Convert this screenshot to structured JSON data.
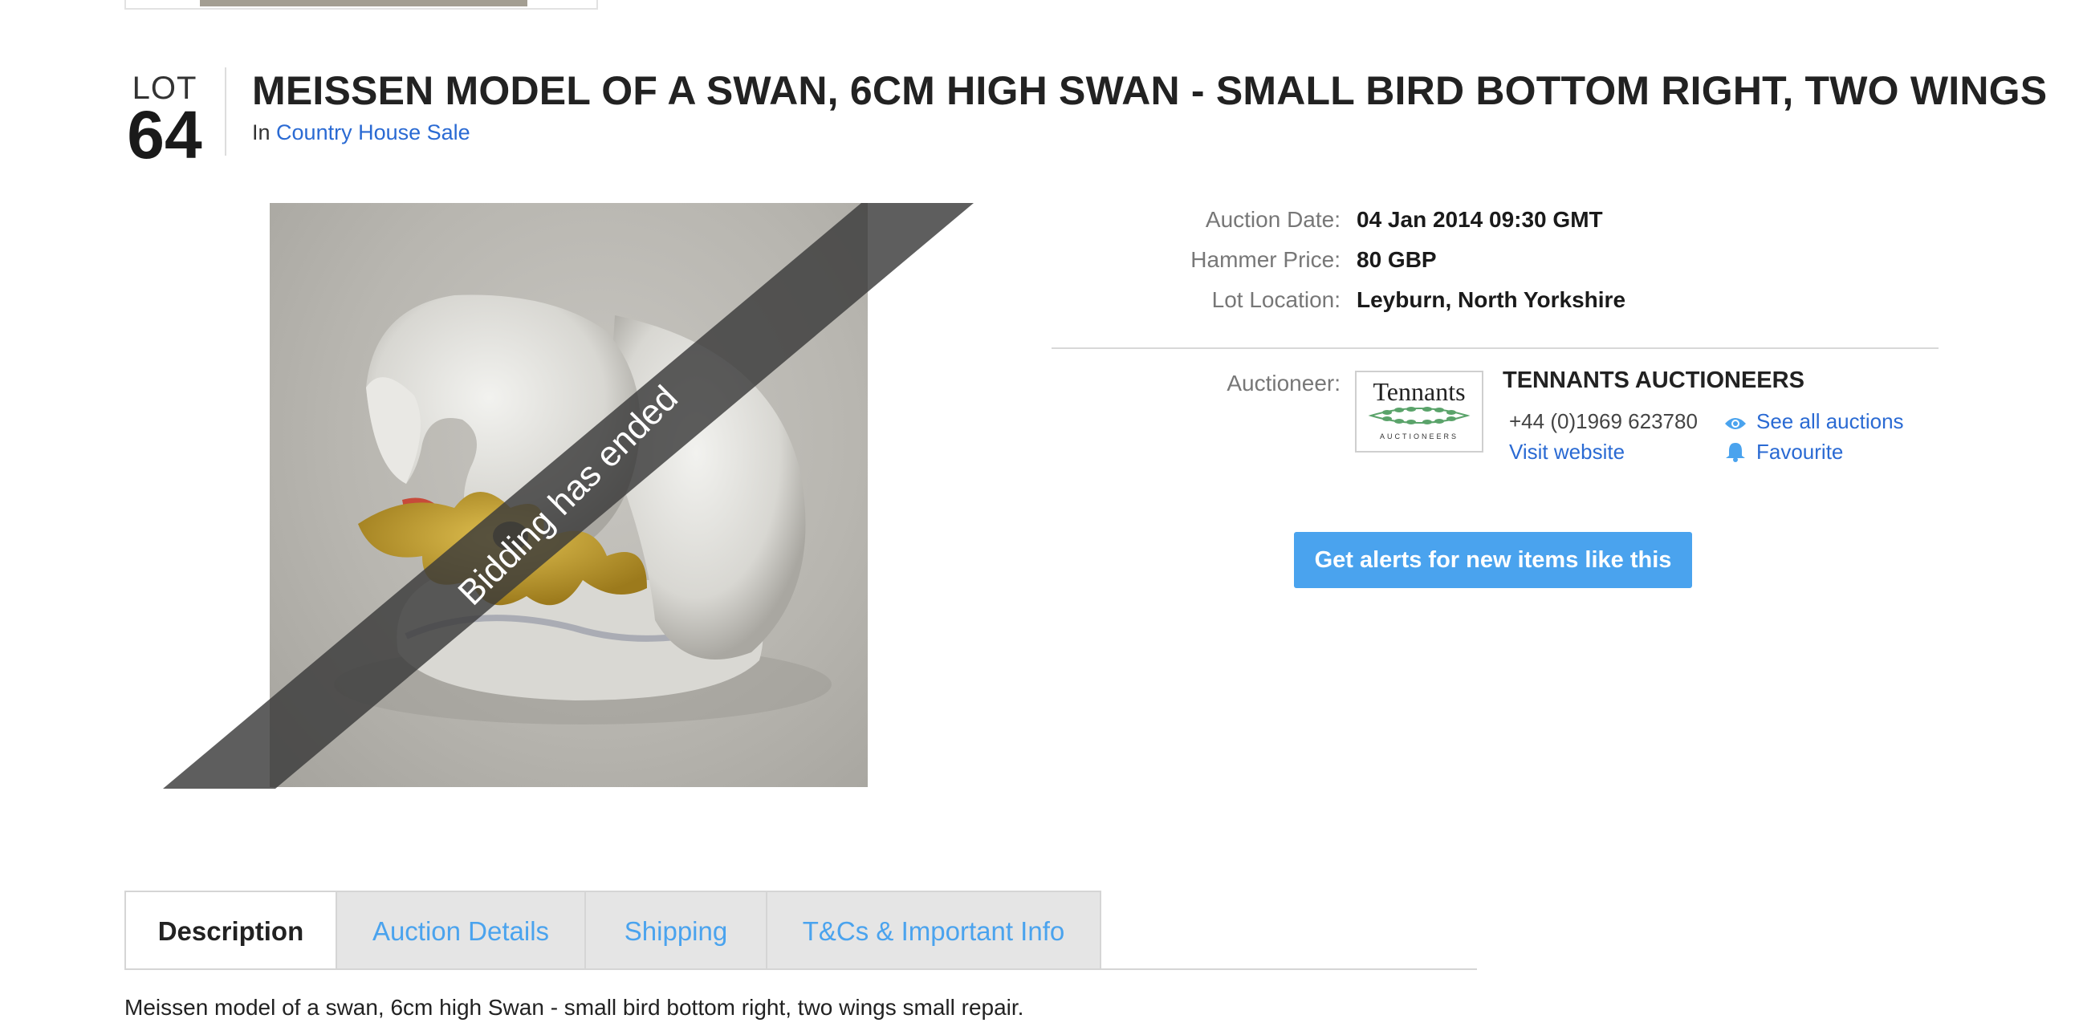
{
  "lot": {
    "label": "LOT",
    "number": "64"
  },
  "title": "MEISSEN MODEL OF A SWAN, 6CM HIGH SWAN - SMALL BIRD BOTTOM RIGHT, TWO WINGS",
  "sale": {
    "prefix": "In",
    "name": "Country House Sale"
  },
  "image": {
    "banner_text": "Bidding has ended"
  },
  "details": [
    {
      "key": "Auction Date:",
      "value": "04 Jan 2014 09:30 GMT"
    },
    {
      "key": "Hammer Price:",
      "value": "80 GBP"
    },
    {
      "key": "Lot Location:",
      "value": "Leyburn, North Yorkshire"
    }
  ],
  "auctioneer": {
    "key": "Auctioneer:",
    "logo_word": "Tennants",
    "logo_sub": "AUCTIONEERS",
    "name": "TENNANTS AUCTIONEERS",
    "phone": "+44 (0)1969 623780",
    "website_label": "Visit website",
    "see_all_label": "See all auctions",
    "favourite_label": "Favourite"
  },
  "alert_button": "Get alerts for new items like this",
  "tabs": [
    {
      "label": "Description",
      "active": true
    },
    {
      "label": "Auction Details",
      "active": false
    },
    {
      "label": "Shipping",
      "active": false
    },
    {
      "label": "T&Cs & Important Info",
      "active": false
    }
  ],
  "description": "Meissen model of a swan, 6cm high Swan - small bird bottom right, two wings small repair.",
  "colors": {
    "link": "#2a6ad3",
    "accent": "#4aa3ee",
    "banner": "#3a3a3a"
  }
}
